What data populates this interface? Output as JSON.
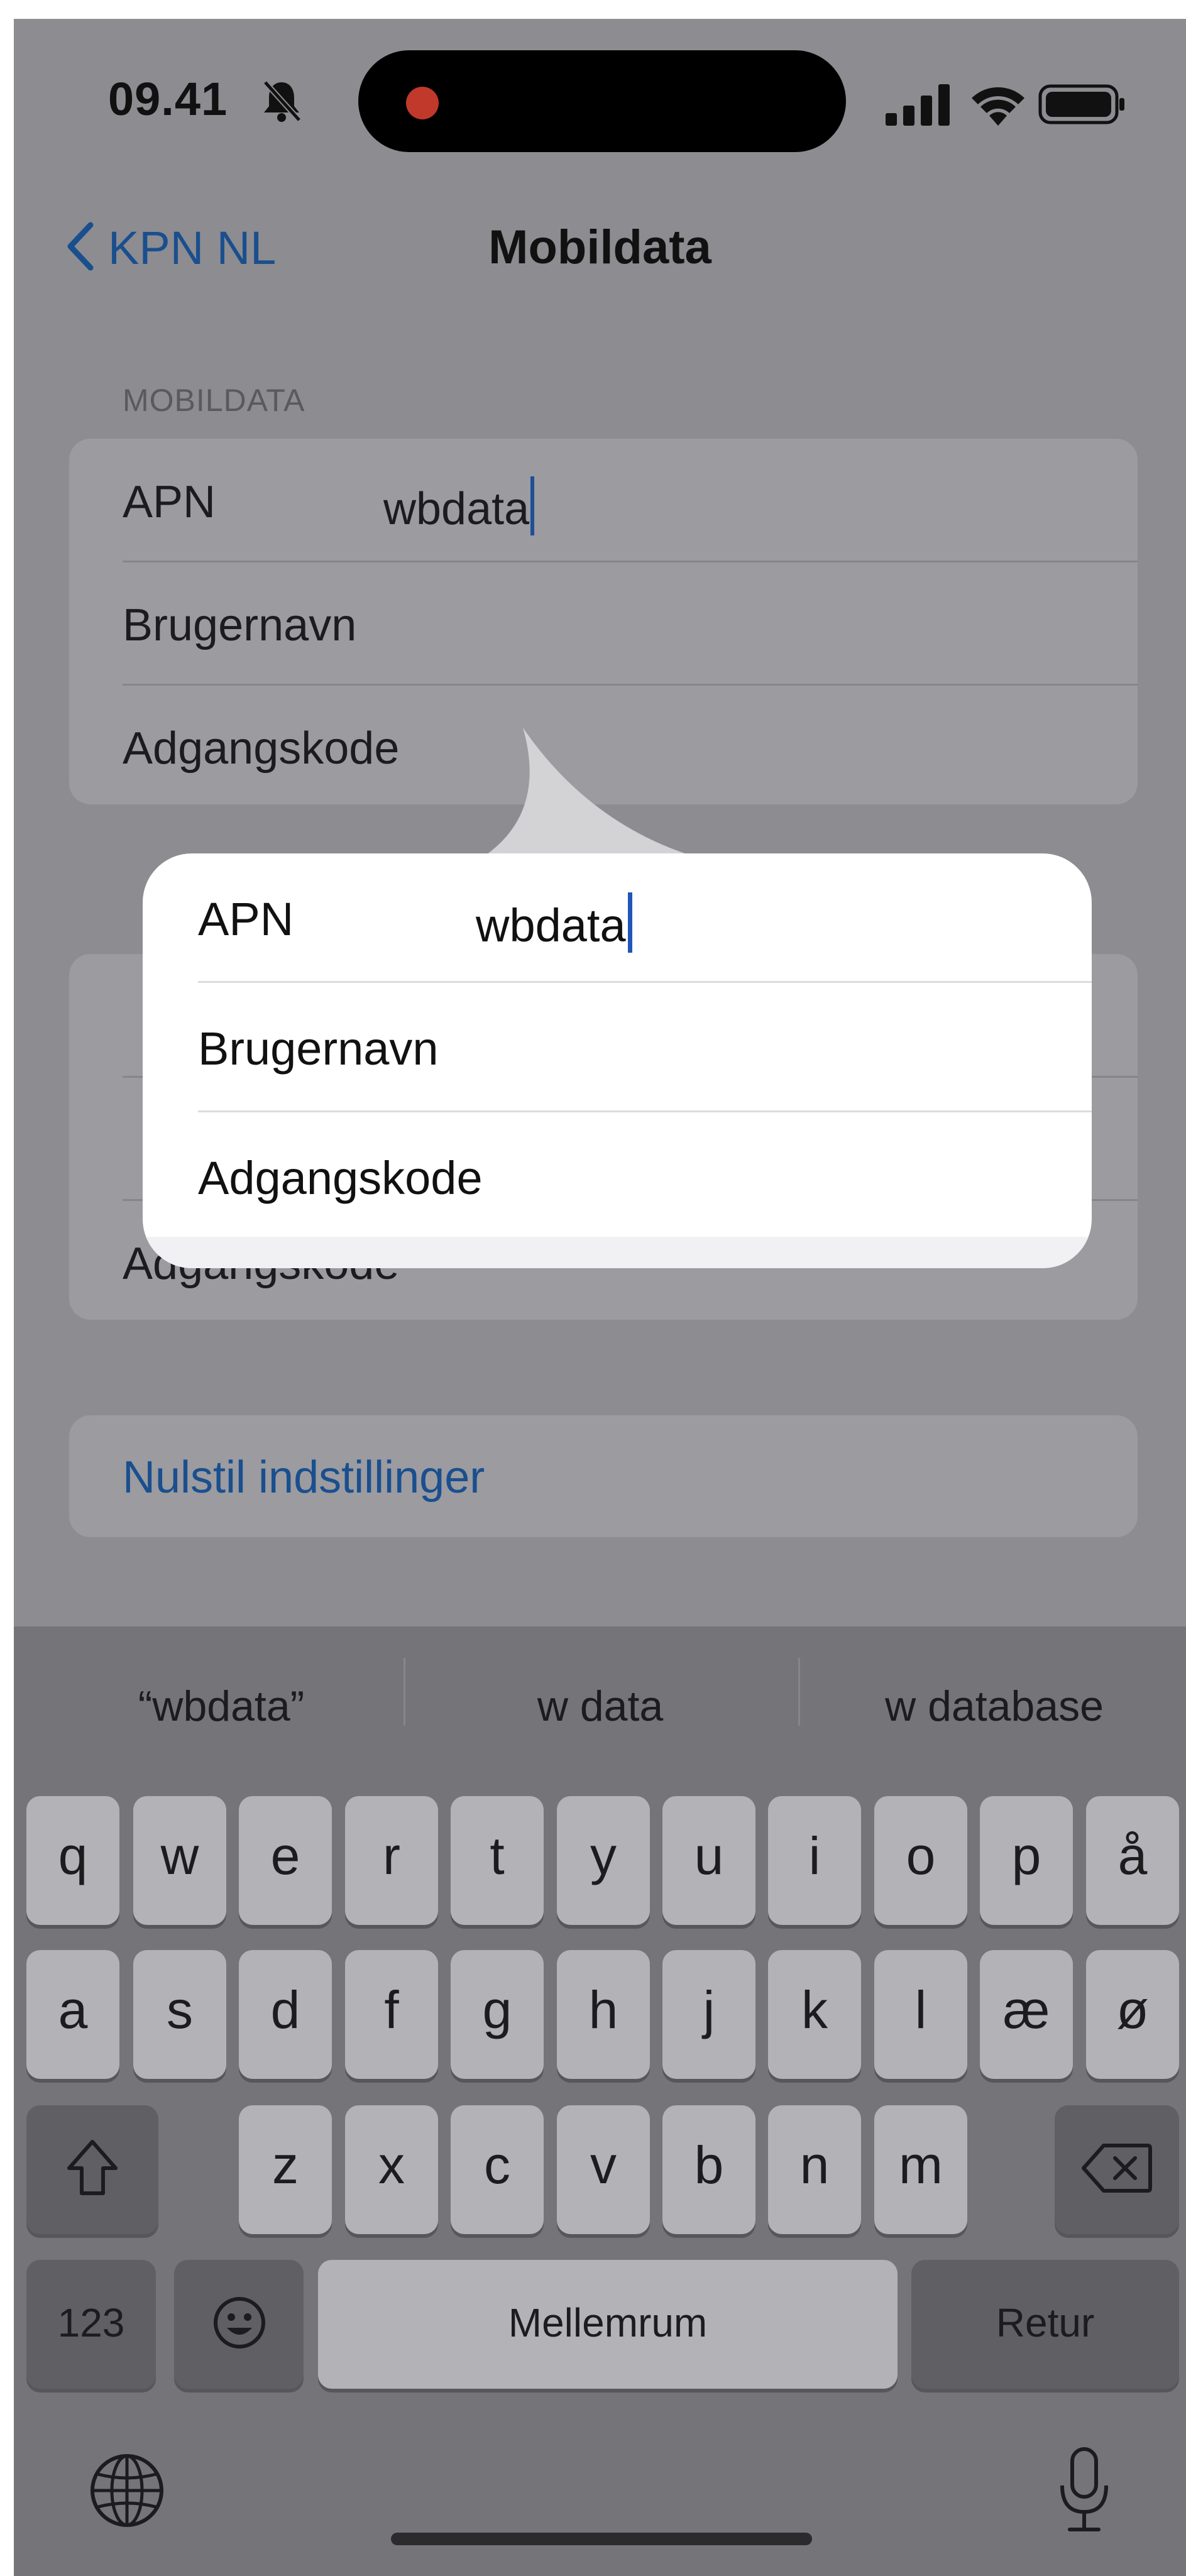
{
  "status_bar": {
    "time": "09.41"
  },
  "nav": {
    "back_label": "KPN NL",
    "title": "Mobildata"
  },
  "section": {
    "header": "MOBILDATA"
  },
  "fields": {
    "apn_label": "APN",
    "apn_value": "wbdata",
    "username_label": "Brugernavn",
    "password_label": "Adgangskode"
  },
  "reset": {
    "label": "Nulstil indstillinger"
  },
  "keyboard": {
    "suggestions": [
      "“wbdata”",
      "w data",
      "w database"
    ],
    "row1": [
      "q",
      "w",
      "e",
      "r",
      "t",
      "y",
      "u",
      "i",
      "o",
      "p",
      "å"
    ],
    "row2": [
      "a",
      "s",
      "d",
      "f",
      "g",
      "h",
      "j",
      "k",
      "l",
      "æ",
      "ø"
    ],
    "row3": [
      "z",
      "x",
      "c",
      "v",
      "b",
      "n",
      "m"
    ],
    "numbers_label": "123",
    "space_label": "Mellemrum",
    "return_label": "Retur"
  },
  "icons": {
    "back": "chevron-left-icon",
    "mute": "bell-slash-icon",
    "signal": "cellular-signal-icon",
    "wifi": "wifi-icon",
    "battery": "battery-icon",
    "shift": "shift-icon",
    "delete": "delete-backward-icon",
    "emoji": "emoji-face-icon",
    "globe": "globe-icon",
    "mic": "microphone-icon"
  },
  "colors": {
    "accent": "#1a4f8e",
    "caret": "#1f56b8",
    "dim_background": "#8c8c91",
    "popup_background": "#ffffff"
  }
}
